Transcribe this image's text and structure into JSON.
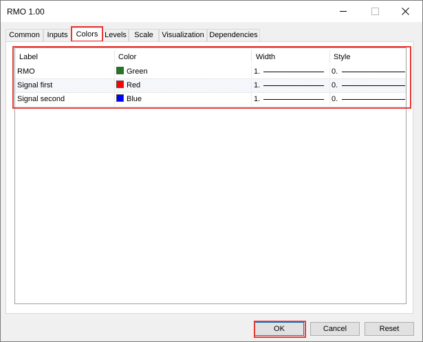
{
  "window": {
    "title": "RMO 1.00"
  },
  "tabs": [
    {
      "label": "Common"
    },
    {
      "label": "Inputs"
    },
    {
      "label": "Colors"
    },
    {
      "label": "Levels"
    },
    {
      "label": "Scale"
    },
    {
      "label": "Visualization"
    },
    {
      "label": "Dependencies"
    }
  ],
  "active_tab": "Colors",
  "grid": {
    "columns": [
      "Label",
      "Color",
      "Width",
      "Style"
    ],
    "rows": [
      {
        "label": "RMO",
        "color_name": "Green",
        "color_hex": "#1e7a1e",
        "width": "1.",
        "style": "0."
      },
      {
        "label": "Signal first",
        "color_name": "Red",
        "color_hex": "#ff0000",
        "width": "1.",
        "style": "0."
      },
      {
        "label": "Signal second",
        "color_name": "Blue",
        "color_hex": "#0000ff",
        "width": "1.",
        "style": "0."
      }
    ]
  },
  "buttons": {
    "ok": "OK",
    "cancel": "Cancel",
    "reset": "Reset"
  },
  "colors": {
    "highlight": "#e53935",
    "focus_border": "#0078d7"
  }
}
